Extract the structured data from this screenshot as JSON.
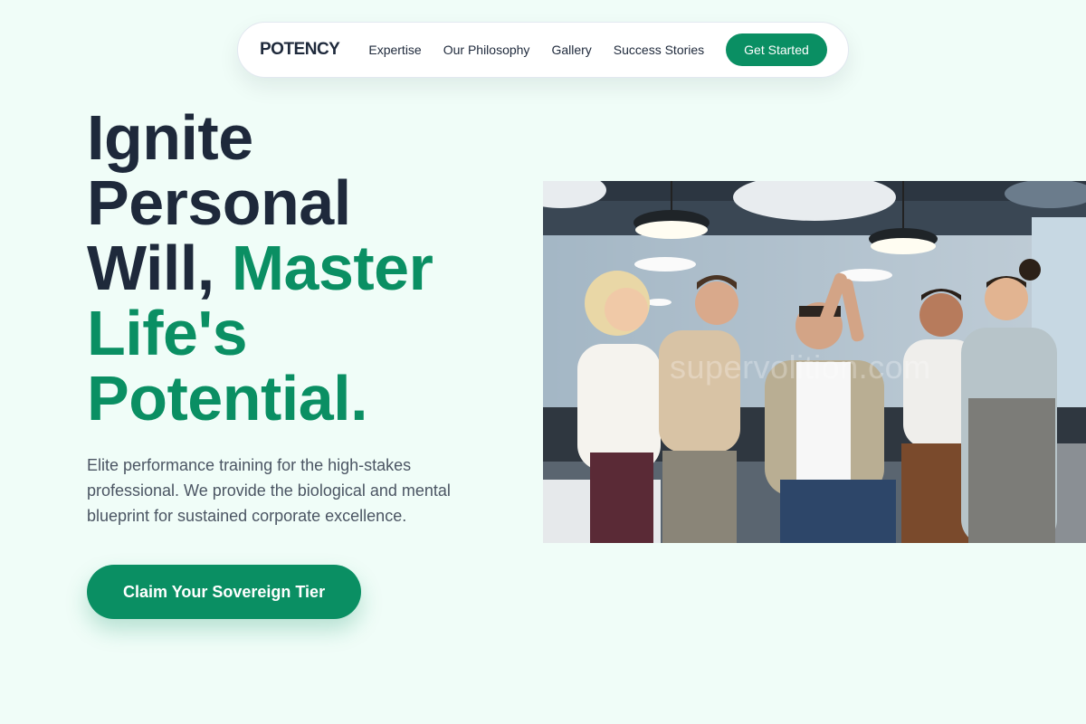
{
  "nav": {
    "logo": "POTENCY",
    "links": [
      "Expertise",
      "Our Philosophy",
      "Gallery",
      "Success Stories"
    ],
    "cta_label": "Get Started"
  },
  "hero": {
    "title_line1": "Ignite",
    "title_line2": "Personal",
    "title_line3a": "Will,",
    "title_line3b": "Master",
    "title_line4": "Life's",
    "title_line5": "Potential.",
    "subtitle": "Elite performance training for the high-stakes professional. We provide the biological and mental blueprint for sustained corporate excellence.",
    "cta_label": "Claim Your Sovereign Tier",
    "image_watermark": "supervolition.com"
  },
  "colors": {
    "accent": "#0a8f63",
    "heading": "#1e293b",
    "background": "#f0fdf8"
  }
}
